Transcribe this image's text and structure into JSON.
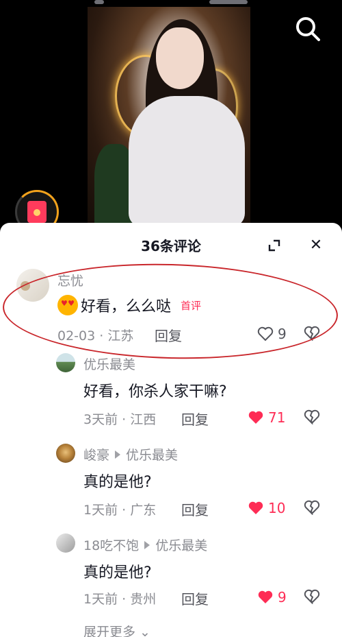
{
  "sheet": {
    "title": "36条评论",
    "close_label": "✕"
  },
  "comments": [
    {
      "author": "忘忧",
      "text": "好看，么么哒",
      "badge": "首评",
      "date": "02-03 · 江苏",
      "reply": "回复",
      "likes": "9",
      "liked": false,
      "emoji": "heart-eyes-emoji"
    },
    {
      "author": "优乐最美",
      "text": "好看，你杀人家干嘛?",
      "date": "3天前 · 江西",
      "reply": "回复",
      "likes": "71",
      "liked": true
    },
    {
      "author": "峻豪",
      "reply_to": "优乐最美",
      "text": "真的是他?",
      "date": "1天前 · 广东",
      "reply": "回复",
      "likes": "10",
      "liked": true
    },
    {
      "author": "18吃不饱",
      "reply_to": "优乐最美",
      "text": "真的是他?",
      "date": "1天前 · 贵州",
      "reply": "回复",
      "likes": "9",
      "liked": true
    }
  ],
  "more_label": "展开更多 ⌄",
  "colors": {
    "like_red": "#fe2c55",
    "annotation": "#c9262b",
    "text_primary": "#161823",
    "text_secondary": "#8a8b91"
  },
  "icons": {
    "search": "search-icon",
    "expand": "expand-icon",
    "close": "close-icon",
    "like": "heart-icon",
    "dislike": "broken-heart-icon",
    "red_packet": "red-packet-icon"
  }
}
